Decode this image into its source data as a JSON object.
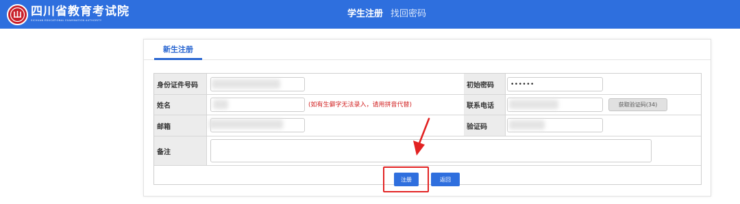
{
  "header": {
    "logo_icon": "seal-logo-icon",
    "site_name": "四川省教育考试院",
    "site_name_en": "SICHUAN EDUCATIONAL EXAMINATION AUTHORITY",
    "nav": [
      {
        "label": "学生注册",
        "active": true
      },
      {
        "label": "找回密码",
        "active": false
      }
    ],
    "bg_color": "#2e6fde"
  },
  "tab": {
    "label": "新生注册"
  },
  "form": {
    "id_label": "身份证件号码",
    "id_value": "",
    "password_label": "初始密码",
    "password_value": "••••••",
    "name_label": "姓名",
    "name_value": "",
    "name_tip": "(如有生僻字无法录入，请用拼音代替)",
    "phone_label": "联系电话",
    "phone_value": "",
    "get_code_button": "获取验证码(34)",
    "email_label": "邮箱",
    "email_value": "",
    "code_label": "验证码",
    "code_value": "",
    "remark_label": "备注",
    "remark_value": ""
  },
  "actions": {
    "register_button": "注册",
    "back_button": "返回"
  },
  "annotation": {
    "highlight_color": "#e22222",
    "arrow_icon": "red-arrow-icon"
  }
}
